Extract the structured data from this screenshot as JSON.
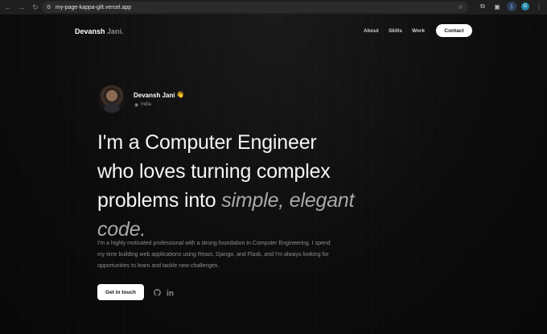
{
  "browser": {
    "url": "my-page-kappa-gilt.vercel.app",
    "profile_initial": "G"
  },
  "header": {
    "brand_first": "Devansh",
    "brand_last": "Jani.",
    "nav": [
      "About",
      "Skills",
      "Work"
    ],
    "contact_label": "Contact"
  },
  "profile": {
    "name": "Devansh Jani",
    "wave": "👋",
    "location": "India"
  },
  "hero": {
    "line1": "I'm a Computer Engineer",
    "line2": "who loves turning complex",
    "line3_plain": "problems into ",
    "line3_em": "simple, elegant",
    "line4_em": "code."
  },
  "intro": "I'm a highly motivated professional with a strong foundation in Computer Engineering. I spend my time building web applications using React, Django, and Flask, and I'm always looking for opportunities to learn and tackle new challenges.",
  "cta": {
    "label": "Get in touch"
  }
}
